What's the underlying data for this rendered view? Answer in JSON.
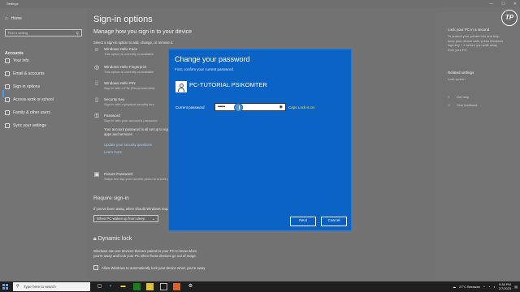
{
  "window": {
    "title": "Settings",
    "controls": [
      "—",
      "☐",
      "✕"
    ]
  },
  "sidebar": {
    "home": "Home",
    "search_placeholder": "Find a setting",
    "section": "Accounts",
    "items": [
      {
        "label": "Your info",
        "icon": "person-icon"
      },
      {
        "label": "Email & accounts",
        "icon": "mail-icon"
      },
      {
        "label": "Sign-in options",
        "icon": "key-icon",
        "active": true
      },
      {
        "label": "Access work or school",
        "icon": "briefcase-icon"
      },
      {
        "label": "Family & other users",
        "icon": "people-icon"
      },
      {
        "label": "Sync your settings",
        "icon": "sync-icon"
      }
    ]
  },
  "main": {
    "title": "Sign-in options",
    "subtitle": "Manage how you sign in to your device",
    "intro": "Select a sign-in option to add, change, or remove it.",
    "options": [
      {
        "title": "Windows Hello Face",
        "sub": "This option is currently unavailable",
        "icon": "face-icon"
      },
      {
        "title": "Windows Hello Fingerprint",
        "sub": "This option is currently unavailable",
        "icon": "fingerprint-icon"
      },
      {
        "title": "Windows Hello PIN",
        "sub": "Sign in with a PIN (Recommended)",
        "icon": "pin-icon"
      },
      {
        "title": "Security Key",
        "sub": "Sign in with a physical security key",
        "icon": "security-key-icon"
      },
      {
        "title": "Password",
        "sub": "Sign in with your account's password",
        "icon": "password-icon"
      }
    ],
    "password_note_1": "Your account password is all set up to sign in to Windows,",
    "password_note_2": "apps and services.",
    "update_link": "Update your security questions",
    "learn_more": "Learn more",
    "picture_password_title": "Picture Password",
    "picture_password_sub": "Swipe and tap your favorite photo to unlock your device",
    "require_signin_title": "Require sign-in",
    "require_signin_desc": "If you've been away, when should Windows require you to sign in again?",
    "require_signin_value": "When PC wakes up from sleep",
    "dynamic_lock_title": "Dynamic lock",
    "dynamic_lock_desc_1": "Windows can use devices that are paired to your PC to know when",
    "dynamic_lock_desc_2": "you're away and lock your PC when those devices go out of range.",
    "dynamic_lock_checkbox": "Allow Windows to automatically lock your device when you're away"
  },
  "right_panel": {
    "lock_title": "Lock your PC in a second",
    "lock_desc": [
      "To protect your private info and help",
      "keep your device safe, press Windows",
      "logo key + L before you walk away",
      "from your PC."
    ],
    "related_title": "Related settings",
    "lock_screen_link": "Lock screen",
    "help_link": "Get help",
    "feedback_link": "Give feedback"
  },
  "dialog": {
    "title": "Change your password",
    "subtitle": "First, confirm your current password.",
    "username": "PC-TUTORIAL PSIKOMTER",
    "password_label": "Current password",
    "password_value": "•••••••",
    "caps_lock": "Caps Lock is on",
    "next": "Next",
    "cancel": "Cancel"
  },
  "logo_text": "TP",
  "taskbar": {
    "search_placeholder": "Type here to search",
    "weather": "27°C  Berawan",
    "time": "9:38 PM",
    "date": "2/7/2023"
  },
  "colors": {
    "dialog_bg": "#0c63c6",
    "caps_warning": "#ffe04a",
    "accent": "#3ea0ff"
  }
}
